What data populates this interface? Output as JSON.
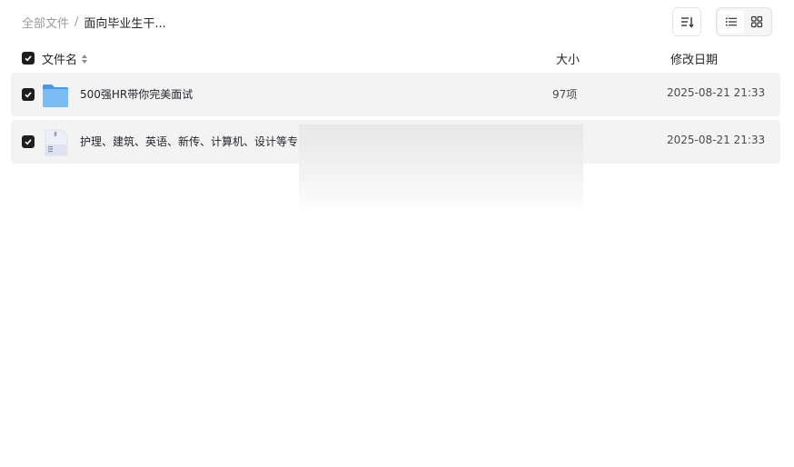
{
  "breadcrumb": {
    "root": "全部文件",
    "separator": "/",
    "current": "面向毕业生干..."
  },
  "toolbar": {
    "sort_icon": "sort-list-icon",
    "view_list_icon": "list-view-icon",
    "view_grid_icon": "grid-view-icon",
    "active_view": "list"
  },
  "columns": {
    "name": "文件名",
    "size": "大小",
    "date": "修改日期"
  },
  "files": [
    {
      "icon": "folder-icon",
      "name": "500强HR带你完美面试",
      "size": "97项",
      "date": "2025-08-21 21:33",
      "checked": true
    },
    {
      "icon": "zip-file-icon",
      "name": "护理、建筑、英语、新传、计算机、设计等专",
      "size": "",
      "date": "2025-08-21 21:33",
      "checked": true
    }
  ],
  "colors": {
    "row_bg": "#f3f3f4",
    "checkbox": "#1e1e1e",
    "folder": "#5fa8f0"
  }
}
